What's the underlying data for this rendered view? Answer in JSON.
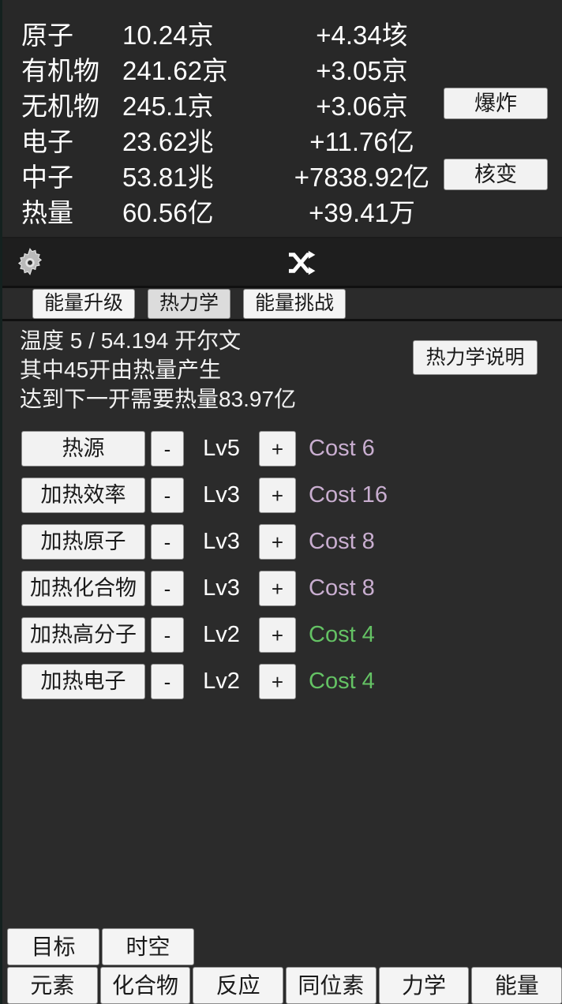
{
  "resources": {
    "rows": [
      {
        "name": "原子",
        "value": "10.24京",
        "delta": "+4.34垓"
      },
      {
        "name": "有机物",
        "value": "241.62京",
        "delta": "+3.05京"
      },
      {
        "name": "无机物",
        "value": "245.1京",
        "delta": "+3.06京"
      },
      {
        "name": "电子",
        "value": "23.62兆",
        "delta": "+11.76亿"
      },
      {
        "name": "中子",
        "value": "53.81兆",
        "delta": "+7838.92亿"
      },
      {
        "name": "热量",
        "value": "60.56亿",
        "delta": "+39.41万"
      }
    ],
    "explode_label": "爆炸",
    "fusion_label": "核变"
  },
  "icon_bar": {
    "gear": "gear-icon",
    "shuffle": "shuffle-icon"
  },
  "tabs": [
    {
      "label": "能量升级",
      "active": false
    },
    {
      "label": "热力学",
      "active": true
    },
    {
      "label": "能量挑战",
      "active": false
    }
  ],
  "info": {
    "line1": "温度 5 / 54.194 开尔文",
    "line2": "其中45开由热量产生",
    "line3": "达到下一开需要热量83.97亿",
    "button_label": "热力学说明"
  },
  "upgrades": {
    "minus_label": "-",
    "plus_label": "+",
    "rows": [
      {
        "name": "热源",
        "level": "Lv5",
        "cost": "Cost 6",
        "cost_color": "#c9aed0"
      },
      {
        "name": "加热效率",
        "level": "Lv3",
        "cost": "Cost 16",
        "cost_color": "#c9aed0"
      },
      {
        "name": "加热原子",
        "level": "Lv3",
        "cost": "Cost 8",
        "cost_color": "#c9aed0"
      },
      {
        "name": "加热化合物",
        "level": "Lv3",
        "cost": "Cost 8",
        "cost_color": "#c9aed0"
      },
      {
        "name": "加热高分子",
        "level": "Lv2",
        "cost": "Cost 4",
        "cost_color": "#64c264"
      },
      {
        "name": "加热电子",
        "level": "Lv2",
        "cost": "Cost 4",
        "cost_color": "#64c264"
      }
    ]
  },
  "bottom_nav": {
    "row1": [
      "目标",
      "时空"
    ],
    "row2": [
      "元素",
      "化合物",
      "反应",
      "同位素",
      "力学",
      "能量"
    ]
  },
  "colors": {
    "background": "#2b2b2b",
    "panel": "#282828",
    "button_face": "#f2f2f2",
    "text": "#ffffff",
    "cost_purple": "#c9aed0",
    "cost_green": "#64c264"
  }
}
